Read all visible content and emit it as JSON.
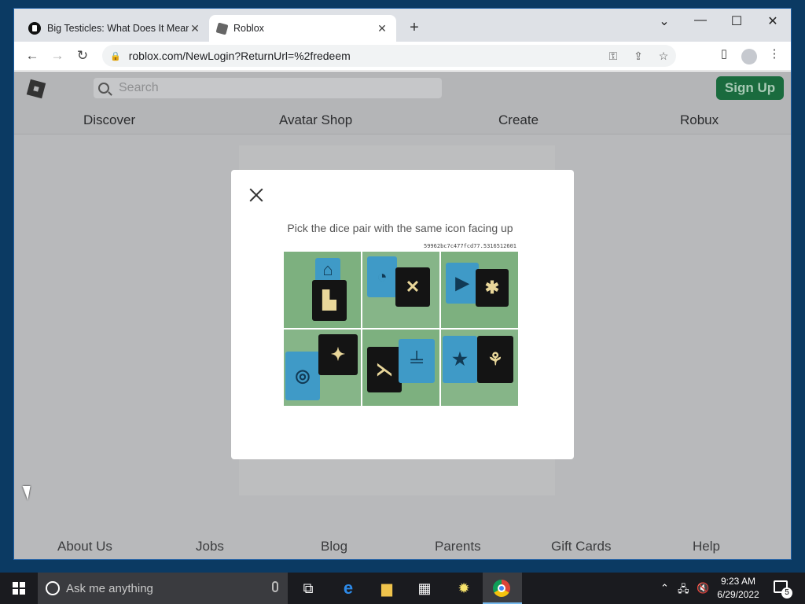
{
  "browser": {
    "tabs": [
      {
        "title": "Big Testicles: What Does It Mean",
        "favicon": "page-favicon",
        "active": false
      },
      {
        "title": "Roblox",
        "favicon": "roblox-favicon",
        "active": true
      }
    ],
    "url": "roblox.com/NewLogin?ReturnUrl=%2fredeem"
  },
  "roblox": {
    "search_placeholder": "Search",
    "signup_label": "Sign Up",
    "nav": [
      "Discover",
      "Avatar Shop",
      "Create",
      "Robux"
    ],
    "footer": [
      "About Us",
      "Jobs",
      "Blog",
      "Parents",
      "Gift Cards",
      "Help"
    ],
    "colors": {
      "signup_bg": "#1a6b3e",
      "overlay": "#b8b9bb"
    }
  },
  "captcha": {
    "prompt": "Pick the dice pair with the same icon facing up",
    "challenge_id": "59962bc7c477fcd77.5316512601",
    "tiles": [
      {
        "label": "tile-1"
      },
      {
        "label": "tile-2"
      },
      {
        "label": "tile-3"
      },
      {
        "label": "tile-4"
      },
      {
        "label": "tile-5"
      },
      {
        "label": "tile-6"
      }
    ]
  },
  "taskbar": {
    "search_placeholder": "Ask me anything",
    "time": "9:23 AM",
    "date": "6/29/2022",
    "notification_count": "5"
  }
}
